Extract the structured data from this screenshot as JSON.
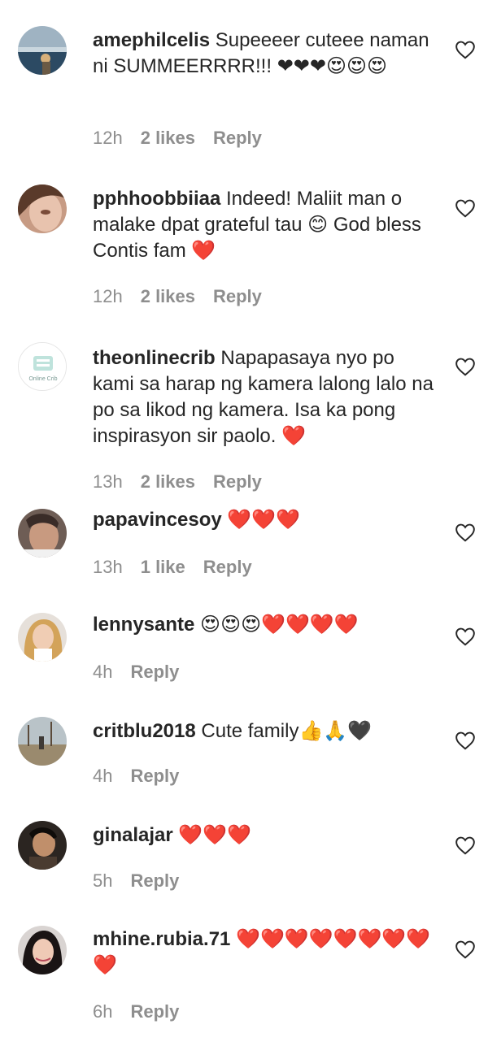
{
  "comments": [
    {
      "username": "amephilcelis",
      "text": " Supeeeer cuteee naman ni SUMMEERRRR!!! ❤❤❤😍😍😍",
      "time": "12h",
      "likes": "2 likes",
      "reply": "Reply"
    },
    {
      "username": "pphhoobbiiaa",
      "text": " Indeed! Maliit man o malake dpat grateful tau 😊 God bless Contis fam ❤️",
      "time": "12h",
      "likes": "2 likes",
      "reply": "Reply"
    },
    {
      "username": "theonlinecrib",
      "text": " Napapasaya nyo po kami sa harap ng kamera lalong lalo na po sa likod ng kamera. Isa ka pong inspirasyon sir paolo. ❤️",
      "time": "13h",
      "likes": "2 likes",
      "reply": "Reply",
      "avatar_text": "Online Crib"
    },
    {
      "username": "papavincesoy",
      "text": " ❤️❤️❤️",
      "time": "13h",
      "likes": "1 like",
      "reply": "Reply"
    },
    {
      "username": "lennysante",
      "text": " 😍😍😍❤️❤️❤️❤️",
      "time": "4h",
      "likes": "",
      "reply": "Reply"
    },
    {
      "username": "critblu2018",
      "text": " Cute family👍🙏🖤",
      "time": "4h",
      "likes": "",
      "reply": "Reply"
    },
    {
      "username": "ginalajar",
      "text": " ❤️❤️❤️",
      "time": "5h",
      "likes": "",
      "reply": "Reply"
    },
    {
      "username": "mhine.rubia.71",
      "text": " ❤️❤️❤️❤️❤️❤️❤️❤️❤️",
      "time": "6h",
      "likes": "",
      "reply": "Reply"
    }
  ],
  "colors": {
    "text": "#262626",
    "muted": "#8e8e8e",
    "heart_emoji": "#e0245e"
  },
  "icons": {
    "like": "heart-outline-icon"
  }
}
